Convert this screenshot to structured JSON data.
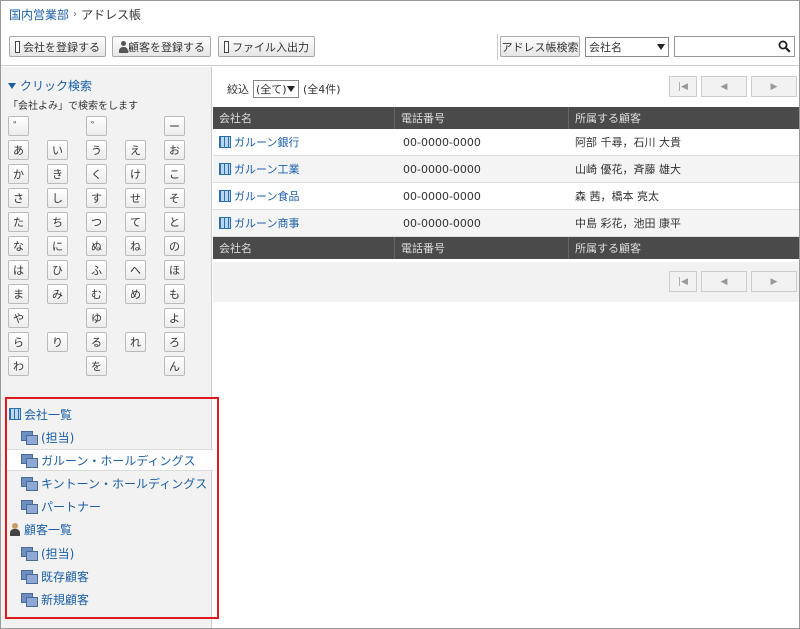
{
  "breadcrumb": {
    "parent": "国内営業部",
    "separator": "›",
    "current": "アドレス帳"
  },
  "toolbar": {
    "register_company": "会社を登録する",
    "register_customer": "顧客を登録する",
    "file_io": "ファイル入出力",
    "address_search": "アドレス帳検索",
    "search_field_selected": "会社名",
    "search_value": ""
  },
  "quick_search": {
    "title": "クリック検索",
    "note": "「会社よみ」で検索をします",
    "kana": [
      [
        "゛",
        "",
        "゜",
        "",
        "ー"
      ],
      [
        "あ",
        "い",
        "う",
        "え",
        "お"
      ],
      [
        "か",
        "き",
        "く",
        "け",
        "こ"
      ],
      [
        "さ",
        "し",
        "す",
        "せ",
        "そ"
      ],
      [
        "た",
        "ち",
        "つ",
        "て",
        "と"
      ],
      [
        "な",
        "に",
        "ぬ",
        "ね",
        "の"
      ],
      [
        "は",
        "ひ",
        "ふ",
        "へ",
        "ほ"
      ],
      [
        "ま",
        "み",
        "む",
        "め",
        "も"
      ],
      [
        "や",
        "",
        "ゆ",
        "",
        "よ"
      ],
      [
        "ら",
        "り",
        "る",
        "れ",
        "ろ"
      ],
      [
        "わ",
        "",
        "を",
        "",
        "ん"
      ]
    ]
  },
  "tree": {
    "company_list": "会社一覧",
    "company_children": [
      "(担当)",
      "ガルーン・ホールディングス",
      "キントーン・ホールディングス",
      "パートナー"
    ],
    "customer_list": "顧客一覧",
    "customer_children": [
      "(担当)",
      "既存顧客",
      "新規顧客"
    ]
  },
  "main": {
    "filter_label": "絞込",
    "filter_value": "(全て)",
    "count": "(全4件)",
    "columns": [
      "会社名",
      "電話番号",
      "所属する顧客"
    ],
    "rows": [
      [
        "ガルーン銀行",
        "00-0000-0000",
        "阿部 千尋，石川 大貴"
      ],
      [
        "ガルーン工業",
        "00-0000-0000",
        "山崎 優花，斉藤 雄大"
      ],
      [
        "ガルーン食品",
        "00-0000-0000",
        "森 茜，橋本 亮太"
      ],
      [
        "ガルーン商事",
        "00-0000-0000",
        "中島 彩花，池田 康平"
      ]
    ]
  }
}
